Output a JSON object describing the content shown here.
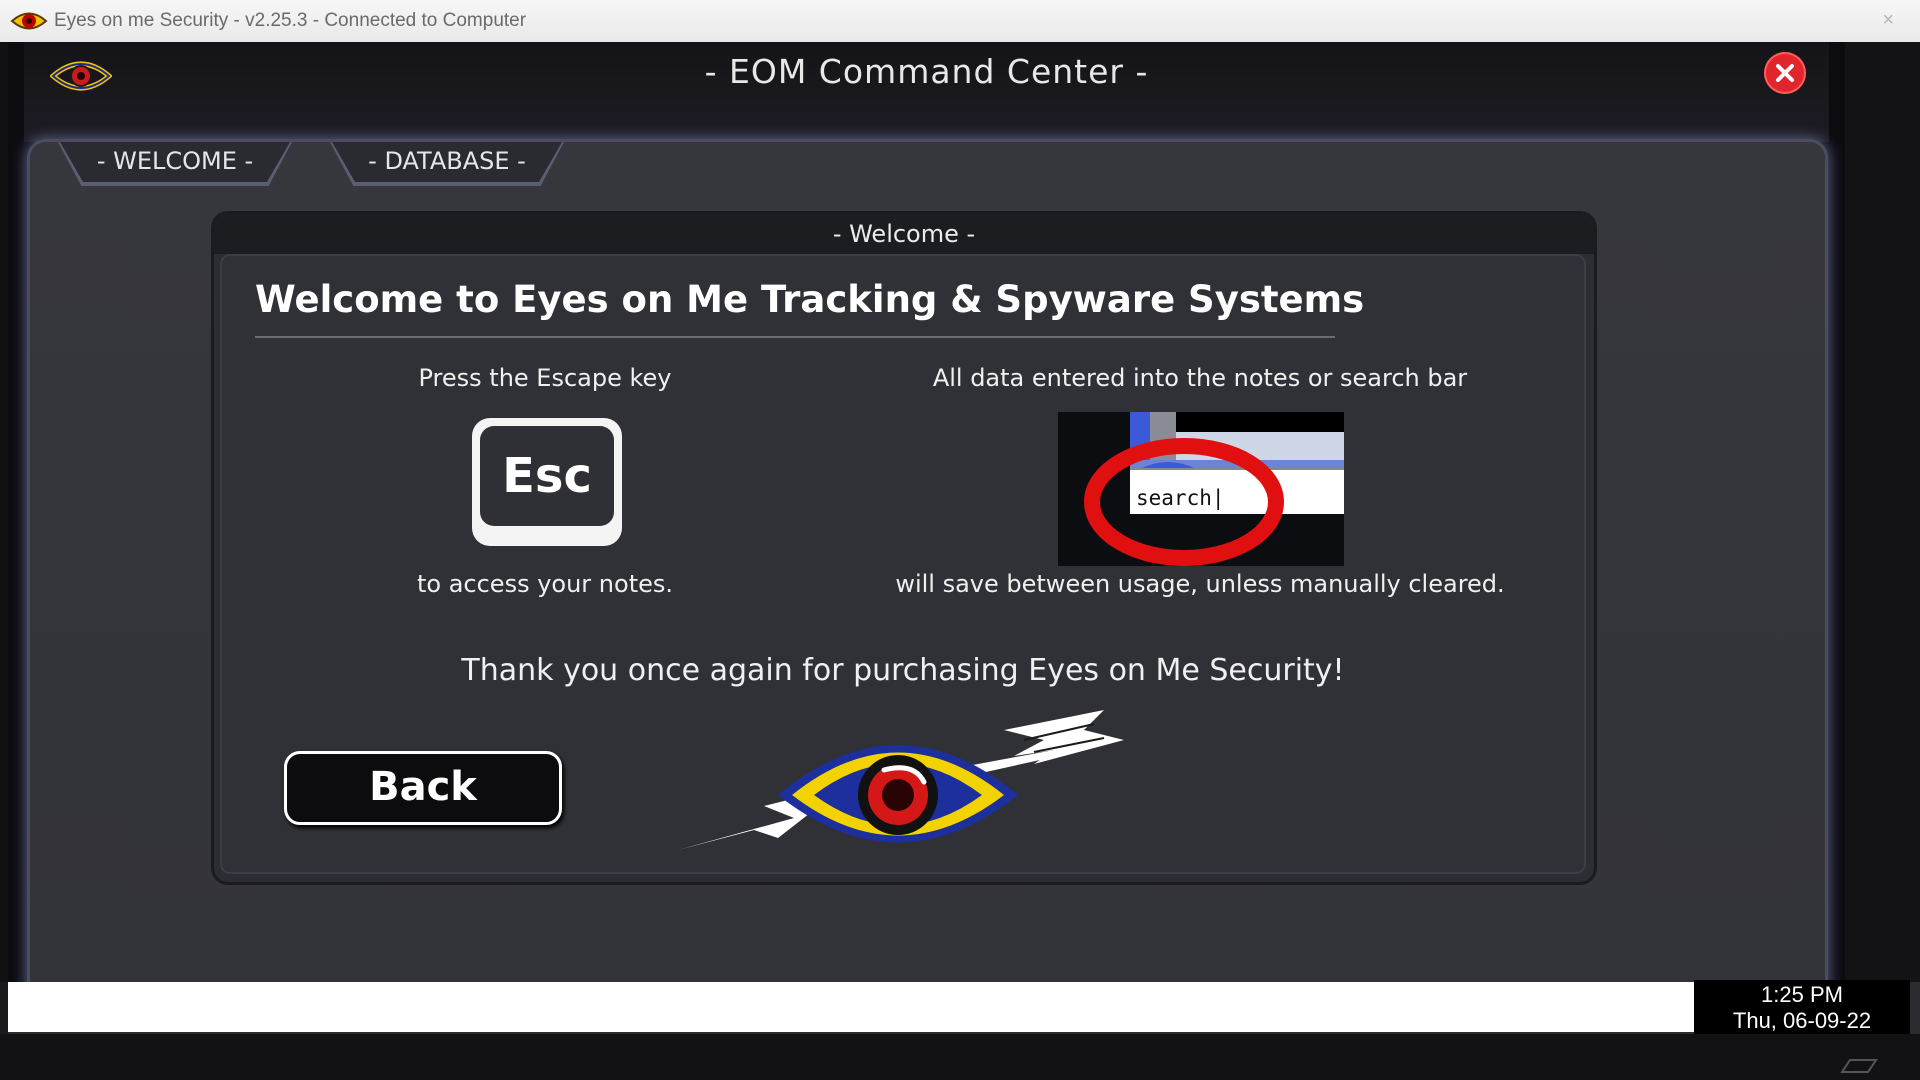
{
  "os_window": {
    "title": "Eyes on me Security - v2.25.3 - Connected to Computer",
    "close_glyph": "×",
    "icon": "eye-icon"
  },
  "app": {
    "title": "- EOM Command Center -",
    "logo_icon": "eye-icon",
    "close_icon": "close-icon",
    "accent_color": "#5a6088",
    "close_color": "#e0252c"
  },
  "tabs": [
    {
      "label": "- WELCOME -",
      "active": true
    },
    {
      "label": "- DATABASE -",
      "active": false
    }
  ],
  "welcome_card": {
    "header": "- Welcome -",
    "heading": "Welcome to Eyes on Me Tracking & Spyware Systems",
    "left_top": "Press the Escape key",
    "esc_key_label": "Esc",
    "left_bottom": "to access your notes.",
    "right_top": "All data entered into the notes or search bar",
    "search_sample_text": "search|",
    "right_bottom": "will save between usage, unless manually cleared.",
    "thank_you": "Thank you once again for purchasing Eyes on Me Security!",
    "back_label": "Back",
    "emblem_icon": "eye-arrow-logo"
  },
  "clock": {
    "time": "1:25 PM",
    "date": "Thu,  06-09-22"
  }
}
